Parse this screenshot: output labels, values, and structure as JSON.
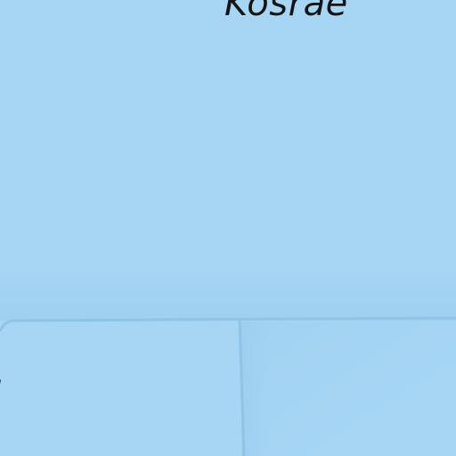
{
  "map": {
    "water_color": "#a6d6f4",
    "border_color": "#8fc4e6",
    "labels": {
      "region_top": "Kosrae",
      "region_left": "i"
    }
  }
}
